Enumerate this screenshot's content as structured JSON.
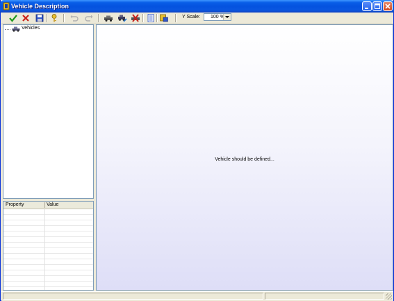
{
  "window": {
    "title": "Vehicle Description",
    "accent_color": "#0452df",
    "close_color": "#d1481f"
  },
  "toolbar": {
    "icons": [
      "check-icon",
      "delete-icon",
      "save-icon",
      "key-icon",
      "undo-icon",
      "redo-icon",
      "vehicle-add-icon",
      "vehicle-edit-icon",
      "vehicle-delete-icon",
      "list-icon",
      "export-icon"
    ],
    "yscale_label": "Y Scale:",
    "yscale_value": "100 %"
  },
  "tree": {
    "root_label": "Vehicles"
  },
  "properties": {
    "columns": [
      "Property",
      "Value"
    ]
  },
  "canvas": {
    "message": "Vehicle should be defined..."
  }
}
